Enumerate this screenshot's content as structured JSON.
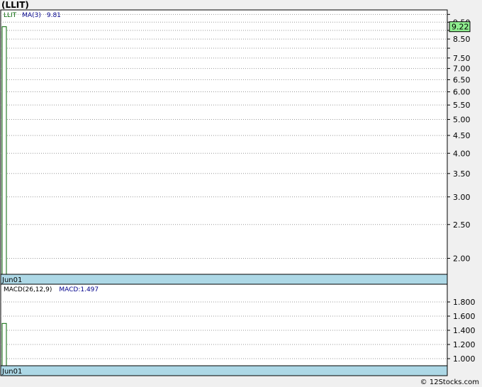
{
  "title": "(LLIT)",
  "footer": "© 12Stocks.com",
  "colors": {
    "price_bar": "#006400",
    "ma_text": "#00008b",
    "last_price_box": "#90ee90",
    "date_band": "#add8e6",
    "grid": "#999999"
  },
  "chart_data": [
    {
      "type": "bar",
      "panel": "price",
      "legend": {
        "symbol": "LLIT",
        "ma_label": "MA(3)",
        "ma_value": "9.81"
      },
      "last_price": "9.22",
      "scale": "log",
      "ylim": [
        1.8,
        10.3
      ],
      "yticks": [
        "9.50",
        "8.50",
        "7.50",
        "7.00",
        "6.50",
        "6.00",
        "5.50",
        "5.00",
        "4.50",
        "4.00",
        "3.50",
        "3.00",
        "2.50",
        "2.00"
      ],
      "grid_values": [
        10.0,
        9.5,
        9.0,
        8.5,
        8.0,
        7.5,
        7.0,
        6.5,
        6.0,
        5.5,
        5.0,
        4.5,
        4.0,
        3.5,
        3.0,
        2.5,
        2.0
      ],
      "x_label": "Jun01",
      "bars": [
        {
          "x": "Jun01",
          "top": 9.22,
          "bottom": 1.8
        }
      ]
    },
    {
      "type": "bar",
      "panel": "macd",
      "legend": {
        "label": "MACD(26,12,9)",
        "value_label": "MACD:1.497"
      },
      "ylim": [
        0.9,
        2.05
      ],
      "yticks": [
        "1.800",
        "1.600",
        "1.400",
        "1.200",
        "1.000"
      ],
      "grid_values": [
        1.8,
        1.6,
        1.4,
        1.2,
        1.0
      ],
      "x_label": "Jun01",
      "bars": [
        {
          "x": "Jun01",
          "value": 1.497
        }
      ]
    }
  ]
}
